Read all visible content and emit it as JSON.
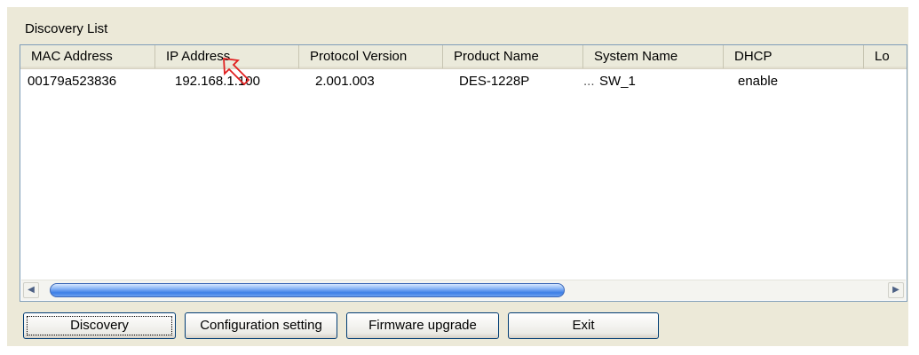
{
  "group": {
    "label": "Discovery List"
  },
  "list": {
    "columns": [
      "MAC Address",
      "IP Address",
      "Protocol Version",
      "Product Name",
      "System Name",
      "DHCP",
      "Lo"
    ],
    "rows": [
      {
        "mac": "00179a523836",
        "ip": "192.168.1.100",
        "protocol": "2.001.003",
        "product": "DES-1228P",
        "product_ellipsis": "...",
        "system": "SW_1",
        "dhcp": "enable"
      }
    ]
  },
  "scrollbar": {
    "left_glyph": "◀",
    "right_glyph": "▶"
  },
  "buttons": {
    "discovery": "Discovery",
    "configuration": "Configuration setting",
    "firmware": "Firmware upgrade",
    "exit": "Exit"
  },
  "colors": {
    "annotation_arrow": "#e02020",
    "list_border": "#7f9db9",
    "panel": "#ece9d8"
  }
}
